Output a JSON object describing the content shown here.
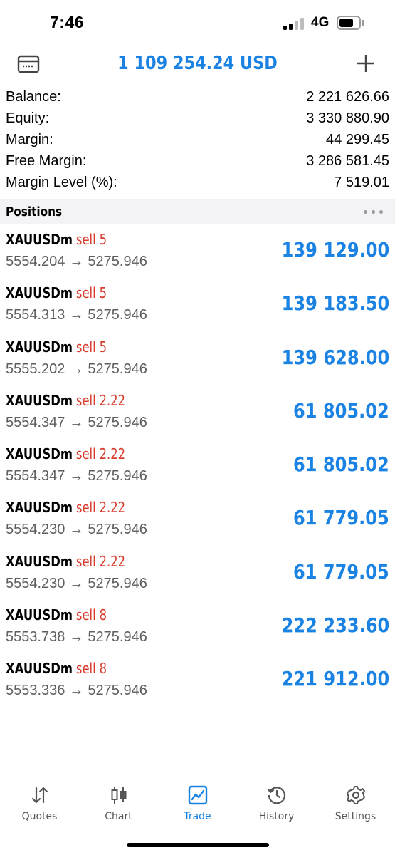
{
  "status_bar": {
    "time": "7:46",
    "network": "4G"
  },
  "header": {
    "balance_title": "1 109 254.24 USD"
  },
  "summary": [
    {
      "label": "Balance:",
      "value": "2 221 626.66"
    },
    {
      "label": "Equity:",
      "value": "3 330 880.90"
    },
    {
      "label": "Margin:",
      "value": "44 299.45"
    },
    {
      "label": "Free Margin:",
      "value": "3 286 581.45"
    },
    {
      "label": "Margin Level (%):",
      "value": "7 519.01"
    }
  ],
  "positions_section": {
    "title": "Positions"
  },
  "positions": [
    {
      "symbol": "XAUUSDm",
      "type": "sell",
      "volume": "5",
      "open_price": "5554.204",
      "arrow": "→",
      "current_price": "5275.946",
      "profit": "139 129.00"
    },
    {
      "symbol": "XAUUSDm",
      "type": "sell",
      "volume": "5",
      "open_price": "5554.313",
      "arrow": "→",
      "current_price": "5275.946",
      "profit": "139 183.50"
    },
    {
      "symbol": "XAUUSDm",
      "type": "sell",
      "volume": "5",
      "open_price": "5555.202",
      "arrow": "→",
      "current_price": "5275.946",
      "profit": "139 628.00"
    },
    {
      "symbol": "XAUUSDm",
      "type": "sell",
      "volume": "2.22",
      "open_price": "5554.347",
      "arrow": "→",
      "current_price": "5275.946",
      "profit": "61 805.02"
    },
    {
      "symbol": "XAUUSDm",
      "type": "sell",
      "volume": "2.22",
      "open_price": "5554.347",
      "arrow": "→",
      "current_price": "5275.946",
      "profit": "61 805.02"
    },
    {
      "symbol": "XAUUSDm",
      "type": "sell",
      "volume": "2.22",
      "open_price": "5554.230",
      "arrow": "→",
      "current_price": "5275.946",
      "profit": "61 779.05"
    },
    {
      "symbol": "XAUUSDm",
      "type": "sell",
      "volume": "2.22",
      "open_price": "5554.230",
      "arrow": "→",
      "current_price": "5275.946",
      "profit": "61 779.05"
    },
    {
      "symbol": "XAUUSDm",
      "type": "sell",
      "volume": "8",
      "open_price": "5553.738",
      "arrow": "→",
      "current_price": "5275.946",
      "profit": "222 233.60"
    },
    {
      "symbol": "XAUUSDm",
      "type": "sell",
      "volume": "8",
      "open_price": "5553.336",
      "arrow": "→",
      "current_price": "5275.946",
      "profit": "221 912.00"
    }
  ],
  "tab_bar": {
    "tabs": [
      {
        "label": "Quotes",
        "icon": "quotes-icon"
      },
      {
        "label": "Chart",
        "icon": "chart-icon"
      },
      {
        "label": "Trade",
        "icon": "trade-icon",
        "active": true
      },
      {
        "label": "History",
        "icon": "history-icon"
      },
      {
        "label": "Settings",
        "icon": "settings-icon"
      }
    ]
  },
  "colors": {
    "accent": "#1a82e2",
    "sell": "#d83a2c",
    "section_bg": "#f3f3f5"
  }
}
